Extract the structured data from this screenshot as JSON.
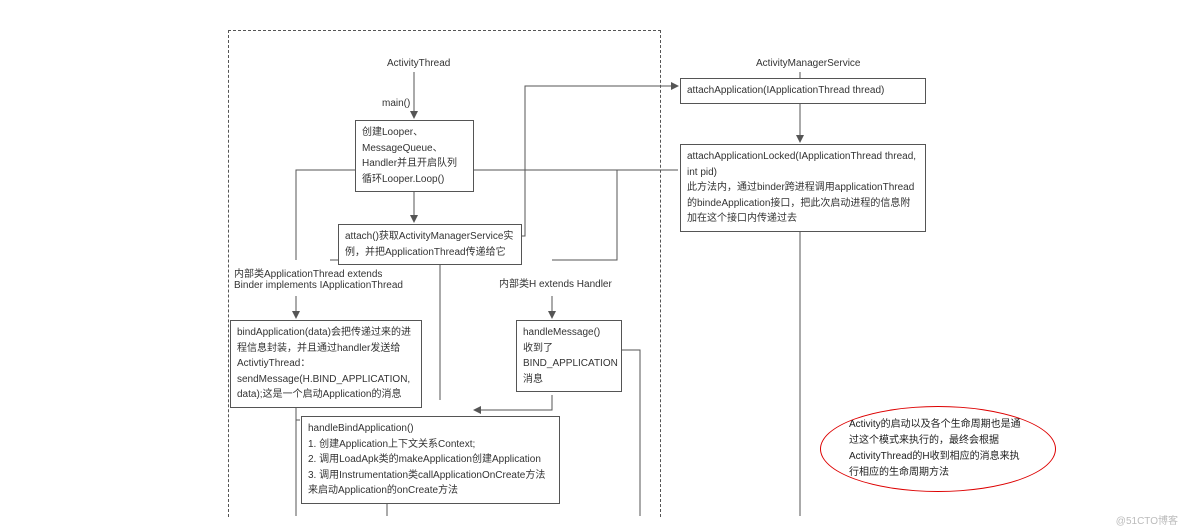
{
  "labels": {
    "activity_thread": "ActivityThread",
    "ams": "ActivityManagerService",
    "main": "main()",
    "inner_app_thread_1": "内部类ApplicationThread extends",
    "inner_app_thread_2": "Binder implements IApplicationThread",
    "inner_h": "内部类H extends Handler"
  },
  "boxes": {
    "looper": "创建Looper、MessageQueue、Handler并且开启队列循环Looper.Loop()",
    "attach": "attach()获取ActivityManagerService实例，并把ApplicationThread传递给它",
    "attach_app": "attachApplication(IApplicationThread thread)",
    "attach_app_locked": "attachApplicationLocked(IApplicationThread thread, int pid)\n此方法内，通过binder跨进程调用applicationThread的bindeApplication接口，把此次启动进程的信息附加在这个接口内传递过去",
    "bind_app": "bindApplication(data)会把传递过来的进程信息封装，并且通过handler发送给ActivtiyThread：sendMessage(H.BIND_APPLICATION, data);这是一个启动Application的消息",
    "handle_msg": "handleMessage()\n收到了BIND_APPLICATION消息",
    "handle_bind": "handleBindApplication()\n1. 创建Application上下文关系Context;\n2. 调用LoadApk类的makeApplication创建Application\n3. 调用Instrumentation类callApplicationOnCreate方法来启动Application的onCreate方法"
  },
  "note": "Activity的启动以及各个生命周期也是通过这个模式来执行的，最终会根据ActivityThread的H收到相应的消息来执行相应的生命周期方法",
  "watermark": "@51CTO博客"
}
